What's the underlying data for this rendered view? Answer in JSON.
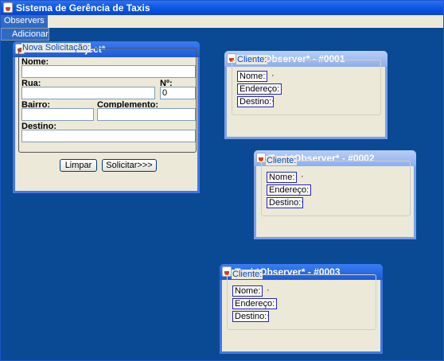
{
  "window": {
    "title": "Sistema de Gerência de Taxis"
  },
  "menubar": {
    "observers": "Observers",
    "popup_item": "Adicionar"
  },
  "central": {
    "title": "Central *Subject*",
    "group_label": "Nova Solicitação:",
    "nome_label": "Nome:",
    "rua_label": "Rua:",
    "numero_label": "Nº:",
    "numero_value": "0",
    "bairro_label": "Bairro:",
    "complemento_label": "Complemento:",
    "destino_label": "Destino:",
    "limpar_label": "Limpar",
    "solicitar_label": "Solicitar>>>"
  },
  "taxis": [
    {
      "title": "Taxi *Observer* - #0001",
      "cliente_label": "Cliente:",
      "nome_label": "Nome:",
      "endereco_label": "Endereço:",
      "destino_label": "Destino:",
      "dot": "·"
    },
    {
      "title": "Taxi *Observer* - #0002",
      "cliente_label": "Cliente:",
      "nome_label": "Nome:",
      "endereco_label": "Endereço:",
      "destino_label": "Destino:",
      "dot": "·"
    },
    {
      "title": "Taxi *Observer* - #0003",
      "cliente_label": "Cliente:",
      "nome_label": "Nome:",
      "endereco_label": "Endereço:",
      "destino_label": "Destino:",
      "dot": "·"
    }
  ]
}
